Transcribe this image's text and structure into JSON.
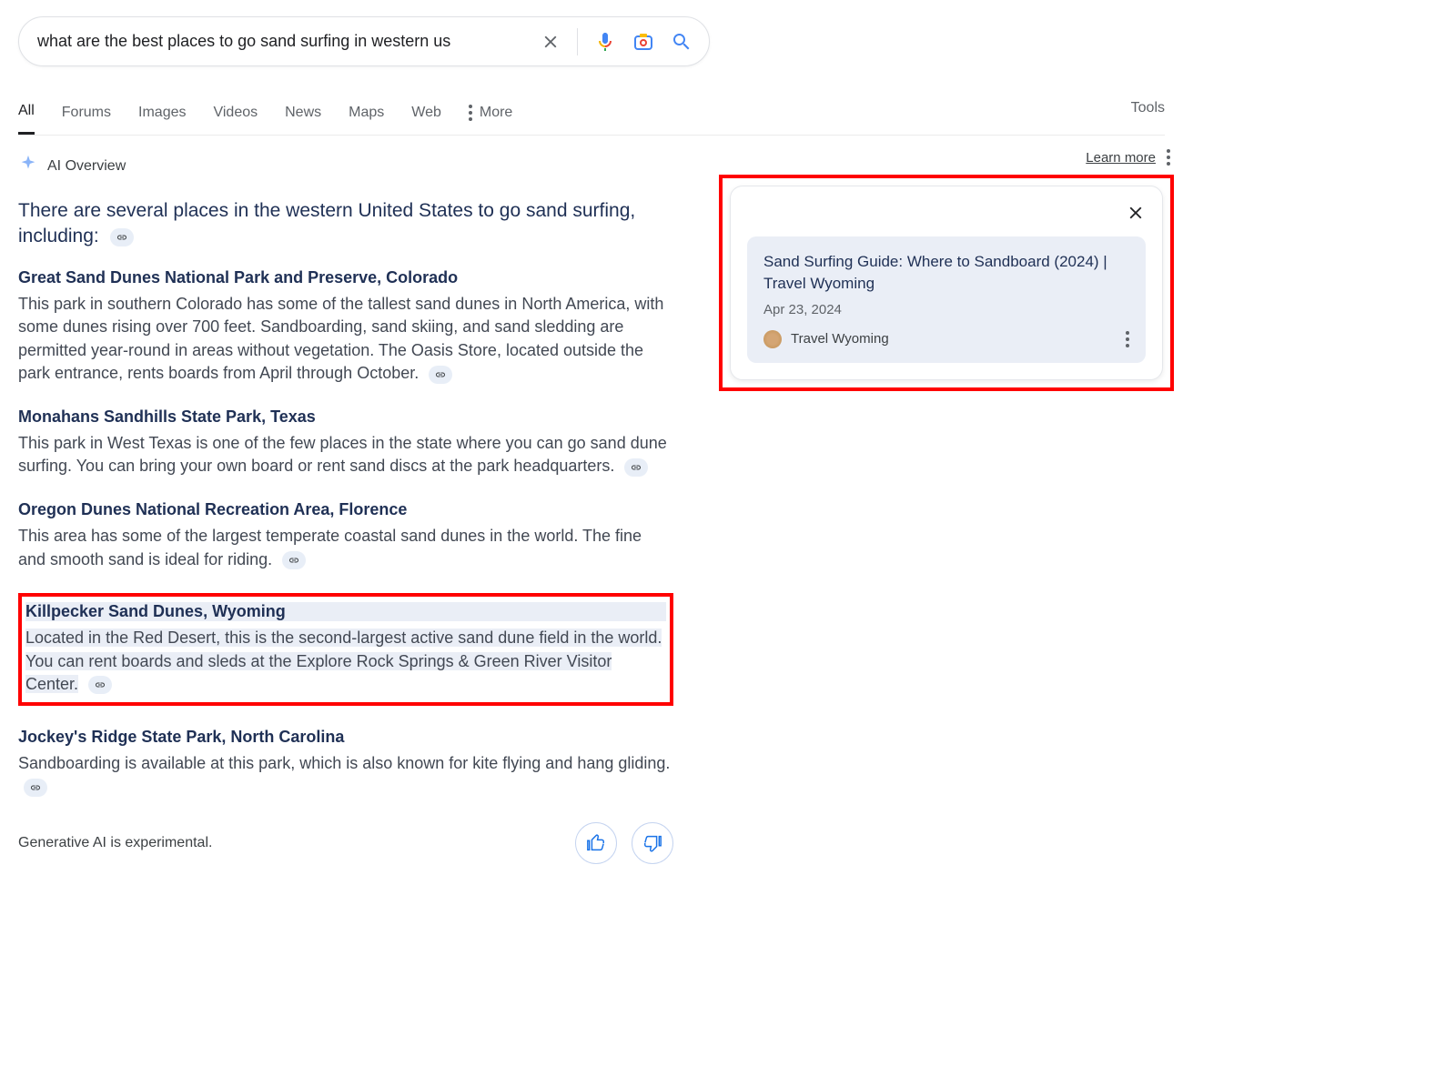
{
  "search": {
    "query": "what are the best places to go sand surfing in western us"
  },
  "tabs": [
    "All",
    "Forums",
    "Images",
    "Videos",
    "News",
    "Maps",
    "Web",
    "More"
  ],
  "tools_label": "Tools",
  "ai_overview": {
    "label": "AI Overview",
    "learn_more": "Learn more",
    "intro": "There are several places in the western United States to go sand surfing, including:",
    "places": [
      {
        "title": "Great Sand Dunes National Park and Preserve, Colorado",
        "desc": "This park in southern Colorado has some of the tallest sand dunes in North America, with some dunes rising over 700 feet. Sandboarding, sand skiing, and sand sledding are permitted year-round in areas without vegetation. The Oasis Store, located outside the park entrance, rents boards from April through October."
      },
      {
        "title": "Monahans Sandhills State Park, Texas",
        "desc": "This park in West Texas is one of the few places in the state where you can go sand dune surfing. You can bring your own board or rent sand discs at the park headquarters."
      },
      {
        "title": "Oregon Dunes National Recreation Area, Florence",
        "desc": "This area has some of the largest temperate coastal sand dunes in the world. The fine and smooth sand is ideal for riding."
      },
      {
        "title": "Killpecker Sand Dunes, Wyoming",
        "desc": "Located in the Red Desert, this is the second-largest active sand dune field in the world. You can rent boards and sleds at the Explore Rock Springs & Green River Visitor Center."
      },
      {
        "title": "Jockey's Ridge State Park, North Carolina",
        "desc": "Sandboarding is available at this park, which is also known for kite flying and hang gliding."
      }
    ],
    "disclaimer": "Generative AI is experimental."
  },
  "source_card": {
    "title": "Sand Surfing Guide: Where to Sandboard (2024) | Travel Wyoming",
    "date": "Apr 23, 2024",
    "site": "Travel Wyoming"
  }
}
